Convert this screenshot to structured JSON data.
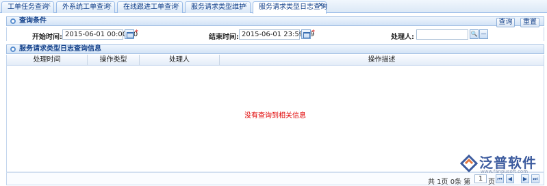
{
  "tabs": [
    {
      "label": "工单任务查询",
      "active": false
    },
    {
      "label": "外系统工单查询",
      "active": false
    },
    {
      "label": "在线跟进工单查询",
      "active": false
    },
    {
      "label": "服务请求类型维护",
      "active": false
    },
    {
      "label": "服务请求类型日志查询",
      "active": true
    }
  ],
  "close_glyph": "×",
  "conditions": {
    "title": "查询条件",
    "query_button": "查询",
    "reset_button": "重置",
    "start_label": "开始时间:",
    "start_value": "2015-06-01 00:00:00",
    "end_label": "结束时间:",
    "end_value": "2015-06-01 23:59:59",
    "handler_label": "处理人:",
    "handler_value": "",
    "required_mark": "*",
    "search_glyph": "🔍",
    "clear_glyph": "—"
  },
  "results": {
    "title": "服务请求类型日志查询信息",
    "columns": [
      "处理时间",
      "操作类型",
      "处理人",
      "操作描述"
    ],
    "empty_message": "没有查询到相关信息"
  },
  "pager": {
    "summary": "共 1页 0条 第",
    "page": "1",
    "page_suffix": "页",
    "first": "⏮",
    "prev": "◀",
    "next": "▶",
    "last": "⏭"
  },
  "watermark": {
    "brand": "泛普软件",
    "url": "www.fanpusoft.com"
  },
  "colors": {
    "accent": "#15428b",
    "border": "#99bbe8",
    "required": "#e02020",
    "empty_text": "#e00000"
  }
}
